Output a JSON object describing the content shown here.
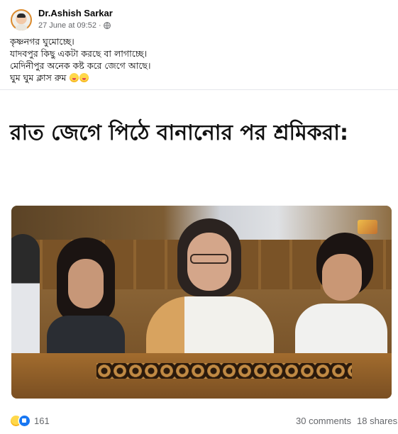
{
  "post": {
    "author": "Dr.Ashish Sarkar",
    "timestamp": "27 June at 09:52",
    "separator": "·",
    "privacy_icon": "globe-icon",
    "text_lines": [
      "কৃষ্ণনগর ঘুমোচ্ছে।",
      "যাদবপুর কিছু একটা করছে বা লাগাচ্ছে।",
      "মেদিনীপুর অনেক কষ্ট করে জেগে আছে।",
      "ঘুম ঘুম ক্লাস রুম"
    ],
    "text_emojis": [
      "squinting-tongue-emoji",
      "squinting-tongue-emoji"
    ]
  },
  "media": {
    "caption": "রাত জেগে পিঠে বানানোর পর শ্রমিকরা:"
  },
  "footer": {
    "reaction_icons": [
      "haha-reaction-icon",
      "like-reaction-icon"
    ],
    "reaction_count": "161",
    "comments": "30 comments",
    "shares": "18 shares"
  },
  "colors": {
    "secondary_text": "#65676b",
    "divider": "#e4e6eb",
    "like_blue": "#1877f2"
  }
}
